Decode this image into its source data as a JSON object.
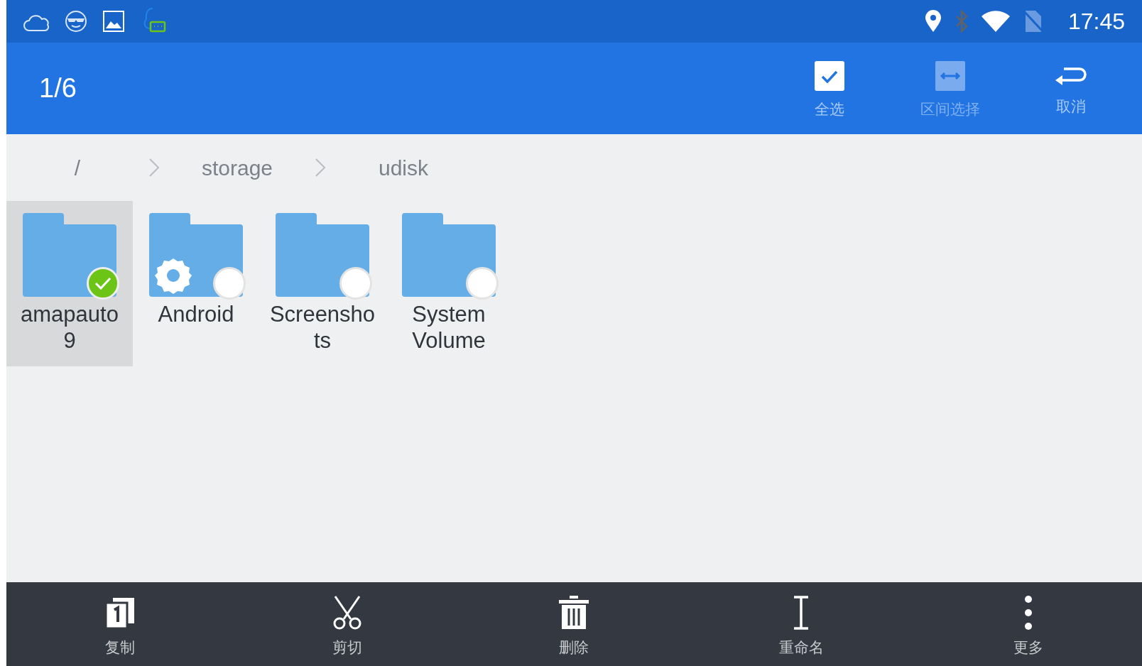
{
  "status_bar": {
    "time": "17:45"
  },
  "header": {
    "count": "1/6",
    "actions": [
      {
        "label": "全选",
        "kind": "select-all",
        "disabled": false
      },
      {
        "label": "区间选择",
        "kind": "range",
        "disabled": true
      },
      {
        "label": "取消",
        "kind": "cancel",
        "disabled": false
      }
    ]
  },
  "breadcrumbs": [
    "/",
    "storage",
    "udisk"
  ],
  "files": [
    {
      "name": "amapauto9",
      "kind": "folder",
      "selected": true
    },
    {
      "name": "Android",
      "kind": "settings-folder",
      "selected": false
    },
    {
      "name": "Screenshots",
      "kind": "folder",
      "selected": false
    },
    {
      "name": "System Volume",
      "kind": "folder",
      "selected": false
    }
  ],
  "toolbar": [
    {
      "label": "复制",
      "kind": "copy"
    },
    {
      "label": "剪切",
      "kind": "cut"
    },
    {
      "label": "删除",
      "kind": "delete"
    },
    {
      "label": "重命名",
      "kind": "rename"
    },
    {
      "label": "更多",
      "kind": "more"
    }
  ]
}
